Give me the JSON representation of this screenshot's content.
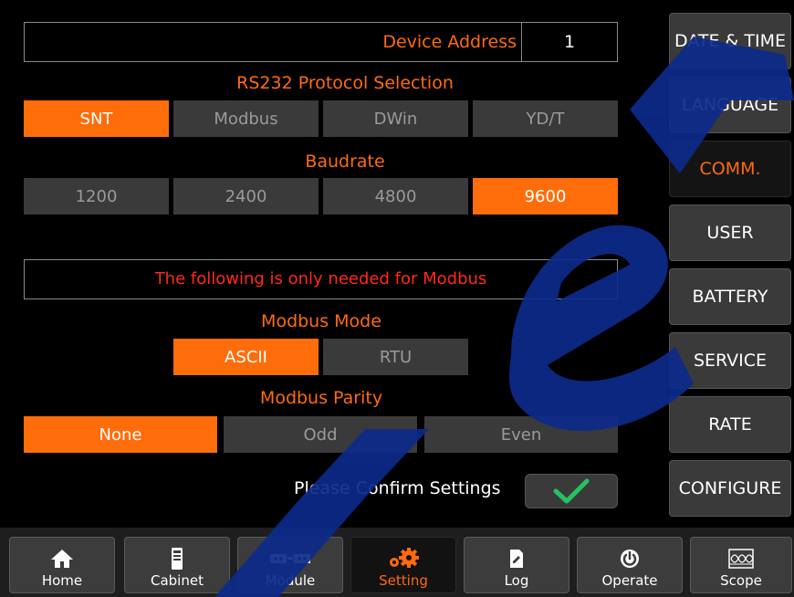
{
  "device_address": {
    "label": "Device Address",
    "value": "1"
  },
  "protocol": {
    "title": "RS232 Protocol Selection",
    "options": [
      "SNT",
      "Modbus",
      "DWin",
      "YD/T"
    ],
    "selected": "SNT"
  },
  "baudrate": {
    "title": "Baudrate",
    "options": [
      "1200",
      "2400",
      "4800",
      "9600"
    ],
    "selected": "9600"
  },
  "modbus_notice": "The following is only needed for Modbus",
  "modbus_mode": {
    "title": "Modbus Mode",
    "options": [
      "ASCII",
      "RTU"
    ],
    "selected": "ASCII"
  },
  "modbus_parity": {
    "title": "Modbus Parity",
    "options": [
      "None",
      "Odd",
      "Even"
    ],
    "selected": "None"
  },
  "confirm": {
    "label": "Please Confirm Settings",
    "icon": "check-icon"
  },
  "side_menu": [
    "DATE & TIME",
    "LANGUAGE",
    "COMM.",
    "USER",
    "BATTERY",
    "SERVICE",
    "RATE",
    "CONFIGURE"
  ],
  "side_menu_active": "COMM.",
  "bottom_nav": [
    {
      "label": "Home",
      "icon": "home-icon"
    },
    {
      "label": "Cabinet",
      "icon": "cabinet-icon"
    },
    {
      "label": "Module",
      "icon": "module-icon"
    },
    {
      "label": "Setting",
      "icon": "gear-icon"
    },
    {
      "label": "Log",
      "icon": "log-icon"
    },
    {
      "label": "Operate",
      "icon": "power-icon"
    },
    {
      "label": "Scope",
      "icon": "scope-icon"
    }
  ],
  "bottom_nav_active": "Setting",
  "colors": {
    "accent": "#ff6a10",
    "button": "#3a3a3a",
    "watermark": "#0d2a8a",
    "check": "#22c55e"
  }
}
